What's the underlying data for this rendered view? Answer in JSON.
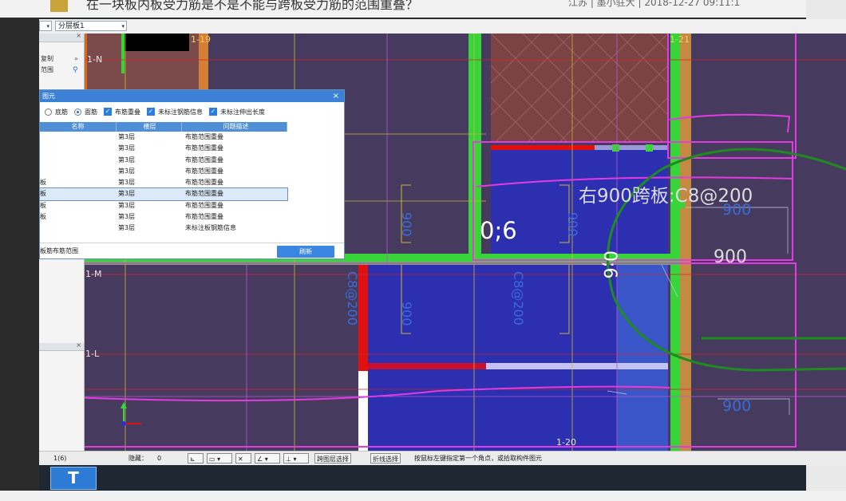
{
  "page": {
    "title_fragment": "在一块板内板受力筋是不是不能与跨板受力筋的范围重叠？",
    "meta_fragment": "江苏 | 墨小驻大 | 2018-12-27 09:11:1"
  },
  "toolbar": {
    "floor_combo_value": "分层板1"
  },
  "side_panel": {
    "rows": [
      "复制",
      "范围"
    ]
  },
  "dialog": {
    "title": "图元",
    "close_label": "×",
    "options": [
      {
        "type": "radio",
        "label": "底筋",
        "checked": false
      },
      {
        "type": "radio",
        "label": "面筋",
        "checked": true
      },
      {
        "type": "checkbox",
        "label": "布筋重叠",
        "checked": true
      },
      {
        "type": "checkbox",
        "label": "未标注钢筋信息",
        "checked": true
      },
      {
        "type": "checkbox",
        "label": "未标注伸出长度",
        "checked": true
      }
    ],
    "columns": [
      "名称",
      "楼层",
      "问题描述"
    ],
    "rows": [
      {
        "name": "",
        "floor": "第3层",
        "desc": "布筋范围重叠"
      },
      {
        "name": "",
        "floor": "第3层",
        "desc": "布筋范围重叠"
      },
      {
        "name": "",
        "floor": "第3层",
        "desc": "布筋范围重叠"
      },
      {
        "name": "",
        "floor": "第3层",
        "desc": "布筋范围重叠"
      },
      {
        "name": "板",
        "floor": "第3层",
        "desc": "布筋范围重叠"
      },
      {
        "name": "板",
        "floor": "第3层",
        "desc": "布筋范围重叠"
      },
      {
        "name": "板",
        "floor": "第3层",
        "desc": "布筋范围重叠"
      },
      {
        "name": "板",
        "floor": "第3层",
        "desc": "布筋范围重叠"
      },
      {
        "name": "",
        "floor": "第3层",
        "desc": "未标注板钢筋信息"
      }
    ],
    "selected_row": 5,
    "footer_text": "板筋布筋范围",
    "refresh_label": "刷新"
  },
  "canvas": {
    "axis_labels": {
      "n": "1-N",
      "m": "1-M",
      "l": "1-L",
      "c19": "1-19",
      "c21": "1-21",
      "c20": "1-20"
    },
    "annotation_main": "右900跨板:C8@200",
    "annotation_06a": "0;6",
    "annotation_06b": "0;6",
    "dim_900": "900",
    "vert_labels": {
      "a": "900",
      "b": "900",
      "c": "900",
      "d": "C8@200",
      "e": "C8@200"
    },
    "colors": {
      "background": "#463b5f",
      "beam": "#38d43a",
      "slab_blue": "#2b2fb0",
      "highlight": "#e23be0",
      "green_marker": "#1f8a1f"
    }
  },
  "statusbar": {
    "layer_text": "1(6)",
    "hidden_label": "隐藏：",
    "hidden_value": "0",
    "btn_cross_layer": "跨图层选择",
    "btn_polyline": "折线选择",
    "hint": "按鼠标左键指定第一个角点，或拾取构件图元"
  },
  "taskbar": {
    "app_icon": "T"
  }
}
